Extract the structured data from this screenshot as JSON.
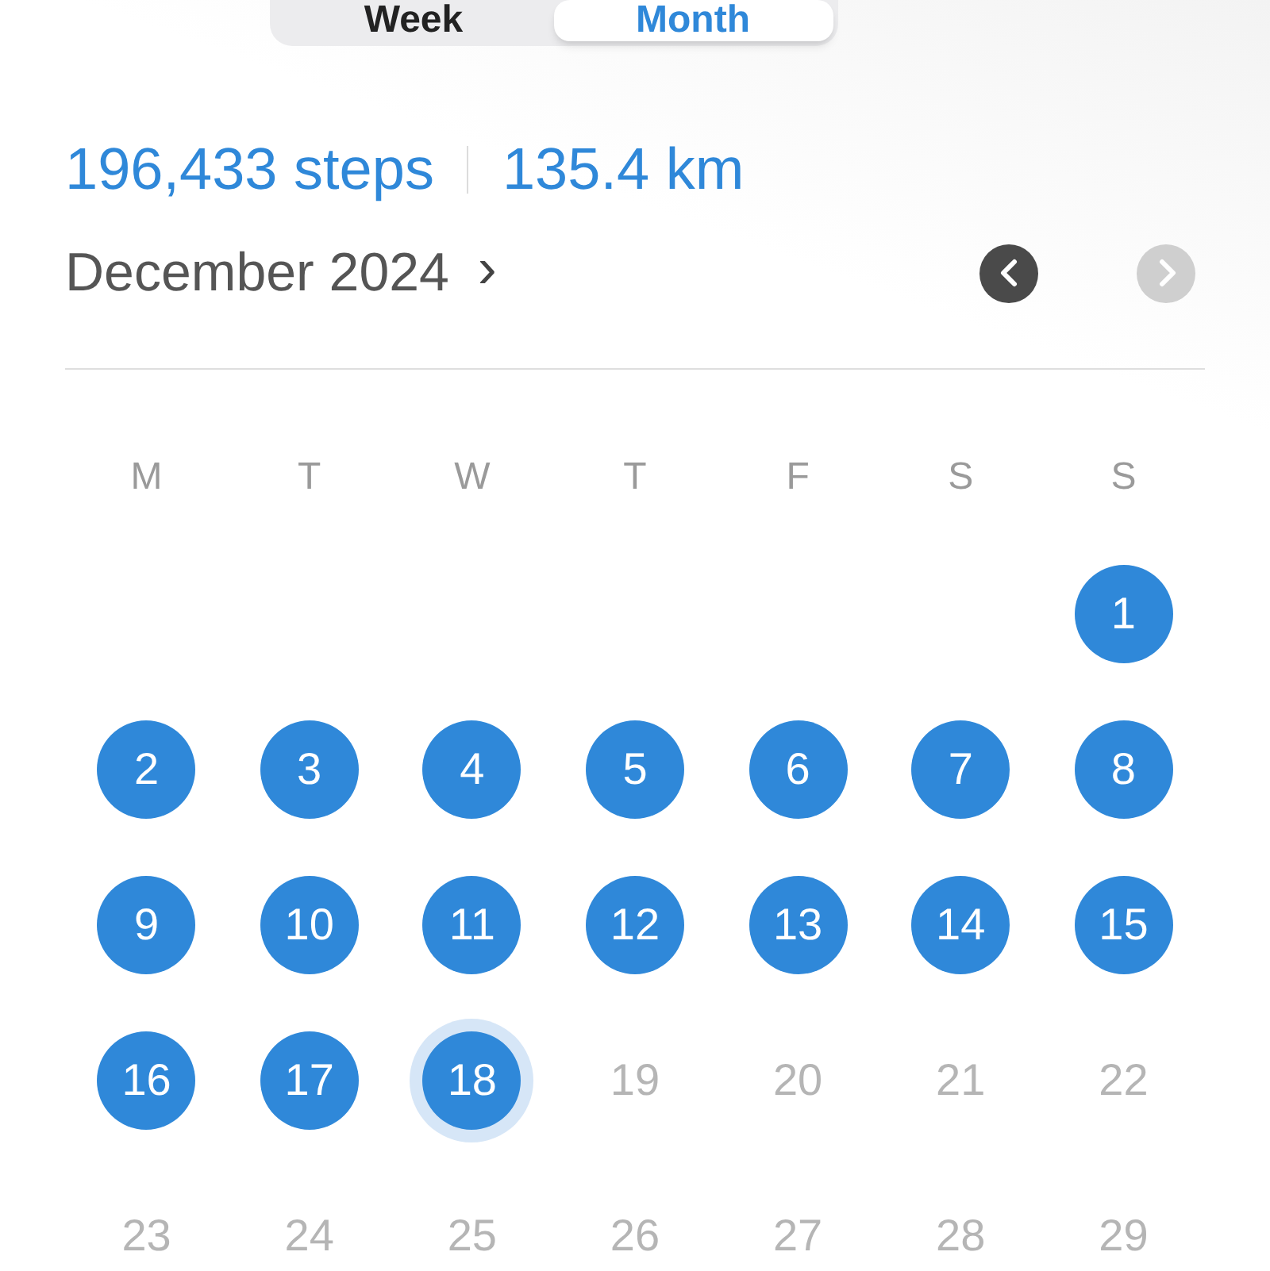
{
  "segments": [
    {
      "label": "Week",
      "selected": false
    },
    {
      "label": "Month",
      "selected": true
    }
  ],
  "summary": {
    "steps": "196,433 steps",
    "distance": "135.4 km"
  },
  "month": {
    "title": "December 2024",
    "chevron": "›"
  },
  "nav": {
    "prev_disabled": false,
    "next_disabled": true
  },
  "weekdays": [
    "M",
    "T",
    "W",
    "T",
    "F",
    "S",
    "S"
  ],
  "days": [
    {
      "label": "1",
      "goal_met": true,
      "today": false
    },
    {
      "label": "2",
      "goal_met": true,
      "today": false
    },
    {
      "label": "3",
      "goal_met": true,
      "today": false
    },
    {
      "label": "4",
      "goal_met": true,
      "today": false
    },
    {
      "label": "5",
      "goal_met": true,
      "today": false
    },
    {
      "label": "6",
      "goal_met": true,
      "today": false
    },
    {
      "label": "7",
      "goal_met": true,
      "today": false
    },
    {
      "label": "8",
      "goal_met": true,
      "today": false
    },
    {
      "label": "9",
      "goal_met": true,
      "today": false
    },
    {
      "label": "10",
      "goal_met": true,
      "today": false
    },
    {
      "label": "11",
      "goal_met": true,
      "today": false
    },
    {
      "label": "12",
      "goal_met": true,
      "today": false
    },
    {
      "label": "13",
      "goal_met": true,
      "today": false
    },
    {
      "label": "14",
      "goal_met": true,
      "today": false
    },
    {
      "label": "15",
      "goal_met": true,
      "today": false
    },
    {
      "label": "16",
      "goal_met": true,
      "today": false
    },
    {
      "label": "17",
      "goal_met": true,
      "today": false
    },
    {
      "label": "18",
      "goal_met": true,
      "today": true
    },
    {
      "label": "19",
      "goal_met": false,
      "today": false
    },
    {
      "label": "20",
      "goal_met": false,
      "today": false
    },
    {
      "label": "21",
      "goal_met": false,
      "today": false
    },
    {
      "label": "22",
      "goal_met": false,
      "today": false
    },
    {
      "label": "23",
      "goal_met": false,
      "today": false
    },
    {
      "label": "24",
      "goal_met": false,
      "today": false
    },
    {
      "label": "25",
      "goal_met": false,
      "today": false
    },
    {
      "label": "26",
      "goal_met": false,
      "today": false
    },
    {
      "label": "27",
      "goal_met": false,
      "today": false
    },
    {
      "label": "28",
      "goal_met": false,
      "today": false
    },
    {
      "label": "29",
      "goal_met": false,
      "today": false
    }
  ]
}
